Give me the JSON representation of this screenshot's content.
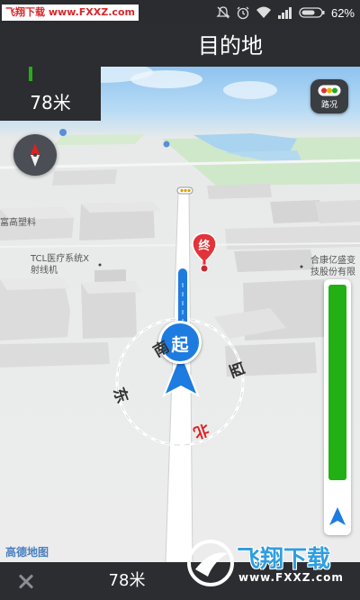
{
  "status_bar": {
    "watermark": "飞翔下载 www.FXXZ.com",
    "battery_percent": "62%",
    "icons": [
      "mute-icon",
      "alarm-icon",
      "wifi-icon",
      "signal-icon",
      "battery-icon"
    ]
  },
  "nav": {
    "destination_title": "目的地",
    "next_turn_distance": "78米",
    "next_turn_icon": "checkered-flag-icon"
  },
  "map": {
    "traffic_button_label": "路况",
    "start_marker_label": "起",
    "end_marker_label": "终",
    "direction_labels": {
      "north": "北",
      "south": "南",
      "east": "东",
      "west": "西"
    },
    "poi_labels": [
      "富高塑料",
      "TCL医疗系统X",
      "射线机",
      "合康亿盛变",
      "技股份有限"
    ],
    "route_progress_remaining": 0.91,
    "amap_logo": "高德地图"
  },
  "bottom_bar": {
    "remaining_distance": "78米"
  },
  "watermark_bottom": {
    "name": "飞翔下载",
    "url": "www.FXXZ.com"
  },
  "colors": {
    "panel_dark": "#2b2d31",
    "route_blue": "#1e7be0",
    "progress_green": "#22b014",
    "end_marker_red": "#e2333a",
    "north_red": "#e02020"
  }
}
